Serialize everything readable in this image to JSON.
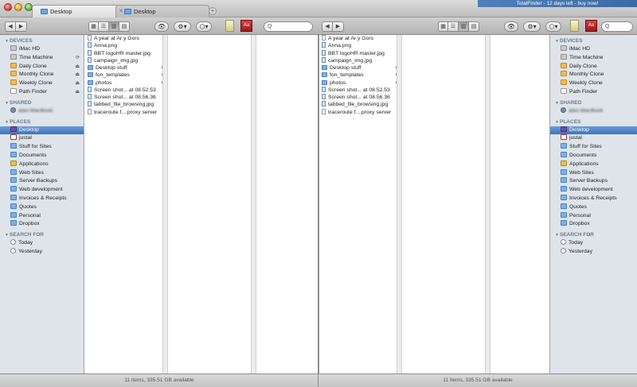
{
  "tabs": [
    {
      "label": "Desktop",
      "close": "✕"
    },
    {
      "label": "Desktop",
      "close": "✕"
    }
  ],
  "tab_add": "+",
  "promo": "TotalFinder - 12 days left - buy now!",
  "toolbar": {
    "back": "◀",
    "forward": "▶",
    "quicklook": "👁",
    "action": "⚙▾",
    "dropbox": "⬡▾",
    "search_placeholder": "Q"
  },
  "red_icon_text": "Aa",
  "sidebar": {
    "devices_heading": "DEVICES",
    "devices": [
      {
        "label": "iMac HD",
        "icon": "drive"
      },
      {
        "label": "Time Machine",
        "icon": "drive",
        "badge": "⟳"
      },
      {
        "label": "Daily Clone",
        "icon": "orange",
        "badge": "⏏"
      },
      {
        "label": "Monthly Clone",
        "icon": "orange",
        "badge": "⏏"
      },
      {
        "label": "Weekly Clone",
        "icon": "orange",
        "badge": "⏏"
      },
      {
        "label": "Path Finder",
        "icon": "doc",
        "badge": "⏏"
      }
    ],
    "shared_heading": "SHARED",
    "shared": [
      {
        "label": "alan-MacBook"
      }
    ],
    "places_heading": "PLACES",
    "places": [
      {
        "label": "Desktop",
        "icon": "desk",
        "selected": true
      },
      {
        "label": "justal",
        "icon": "home"
      },
      {
        "label": "Stuff for Sites",
        "icon": "folder"
      },
      {
        "label": "Documents",
        "icon": "folder"
      },
      {
        "label": "Applications",
        "icon": "app"
      },
      {
        "label": "Web Sites",
        "icon": "folder"
      },
      {
        "label": "Server Backups",
        "icon": "folder"
      },
      {
        "label": "Web development",
        "icon": "folder"
      },
      {
        "label": "Invoices & Receipts",
        "icon": "folder"
      },
      {
        "label": "Quotes",
        "icon": "folder"
      },
      {
        "label": "Personal",
        "icon": "folder"
      },
      {
        "label": "Dropbox",
        "icon": "folder"
      }
    ],
    "search_heading": "SEARCH FOR",
    "search": [
      {
        "label": "Today"
      },
      {
        "label": "Yesterday"
      }
    ]
  },
  "files": [
    {
      "name": "A year at Ar y Gors",
      "type": "doc"
    },
    {
      "name": "Anna.png",
      "type": "img"
    },
    {
      "name": "BBT logoHR master.jpg",
      "type": "img"
    },
    {
      "name": "campaign_img.jpg",
      "type": "img"
    },
    {
      "name": "Desktop stuff",
      "type": "folder",
      "arrow": "▶"
    },
    {
      "name": "fon_templates",
      "type": "folder",
      "arrow": "▶"
    },
    {
      "name": "photos",
      "type": "folder",
      "arrow": "▶"
    },
    {
      "name": "Screen shot... at 08.52.53",
      "type": "img"
    },
    {
      "name": "Screen shot... at 08.56.36",
      "type": "img"
    },
    {
      "name": "tabbed_file_browsing.jpg",
      "type": "img"
    },
    {
      "name": "traceroute f....proxy server",
      "type": "doc"
    }
  ],
  "status": "11 items, 335.51 GB available"
}
